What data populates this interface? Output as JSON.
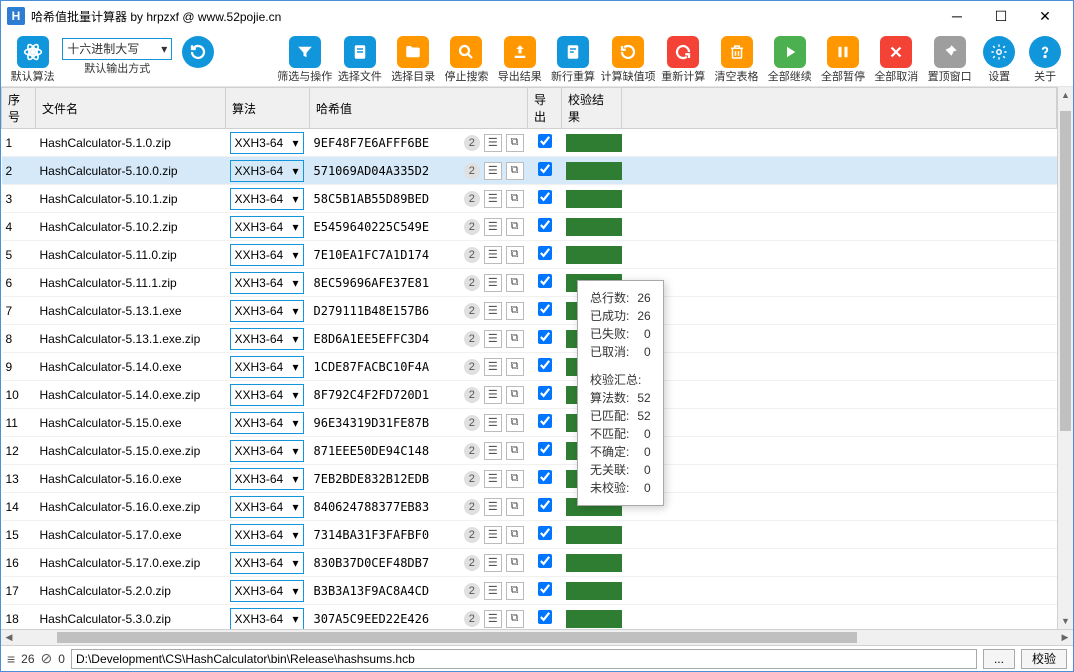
{
  "window": {
    "title": "哈希值批量计算器 by hrpzxf @ www.52pojie.cn"
  },
  "toolbar": {
    "default_algo": "默认算法",
    "output_mode_label": "默认输出方式",
    "output_mode_value": "十六进制大写",
    "filter": "筛选与操作",
    "select_file": "选择文件",
    "select_dir": "选择目录",
    "stop_search": "停止搜索",
    "export": "导出结果",
    "new_recalc": "新行重算",
    "calc_missing": "计算缺值项",
    "recalc": "重新计算",
    "clear": "清空表格",
    "all_continue": "全部继续",
    "all_pause": "全部暂停",
    "all_cancel": "全部取消",
    "pin": "置顶窗口",
    "settings": "设置",
    "about": "关于"
  },
  "columns": {
    "index": "序号",
    "filename": "文件名",
    "algo": "算法",
    "hash": "哈希值",
    "export": "导出",
    "result": "校验结果"
  },
  "rows": [
    {
      "idx": "1",
      "file": "HashCalculator-5.1.0.zip",
      "algo": "XXH3-64",
      "hash": "9EF48F7E6AFFF6BE",
      "cnt": "2",
      "sel": false
    },
    {
      "idx": "2",
      "file": "HashCalculator-5.10.0.zip",
      "algo": "XXH3-64",
      "hash": "571069AD04A335D2",
      "cnt": "2",
      "sel": true
    },
    {
      "idx": "3",
      "file": "HashCalculator-5.10.1.zip",
      "algo": "XXH3-64",
      "hash": "58C5B1AB55D89BED",
      "cnt": "2",
      "sel": false
    },
    {
      "idx": "4",
      "file": "HashCalculator-5.10.2.zip",
      "algo": "XXH3-64",
      "hash": "E5459640225C549E",
      "cnt": "2",
      "sel": false
    },
    {
      "idx": "5",
      "file": "HashCalculator-5.11.0.zip",
      "algo": "XXH3-64",
      "hash": "7E10EA1FC7A1D174",
      "cnt": "2",
      "sel": false
    },
    {
      "idx": "6",
      "file": "HashCalculator-5.11.1.zip",
      "algo": "XXH3-64",
      "hash": "8EC59696AFE37E81",
      "cnt": "2",
      "sel": false
    },
    {
      "idx": "7",
      "file": "HashCalculator-5.13.1.exe",
      "algo": "XXH3-64",
      "hash": "D279111B48E157B6",
      "cnt": "2",
      "sel": false
    },
    {
      "idx": "8",
      "file": "HashCalculator-5.13.1.exe.zip",
      "algo": "XXH3-64",
      "hash": "E8D6A1EE5EFFC3D4",
      "cnt": "2",
      "sel": false
    },
    {
      "idx": "9",
      "file": "HashCalculator-5.14.0.exe",
      "algo": "XXH3-64",
      "hash": "1CDE87FACBC10F4A",
      "cnt": "2",
      "sel": false
    },
    {
      "idx": "10",
      "file": "HashCalculator-5.14.0.exe.zip",
      "algo": "XXH3-64",
      "hash": "8F792C4F2FD720D1",
      "cnt": "2",
      "sel": false
    },
    {
      "idx": "11",
      "file": "HashCalculator-5.15.0.exe",
      "algo": "XXH3-64",
      "hash": "96E34319D31FE87B",
      "cnt": "2",
      "sel": false
    },
    {
      "idx": "12",
      "file": "HashCalculator-5.15.0.exe.zip",
      "algo": "XXH3-64",
      "hash": "871EEE50DE94C148",
      "cnt": "2",
      "sel": false
    },
    {
      "idx": "13",
      "file": "HashCalculator-5.16.0.exe",
      "algo": "XXH3-64",
      "hash": "7EB2BDE832B12EDB",
      "cnt": "2",
      "sel": false
    },
    {
      "idx": "14",
      "file": "HashCalculator-5.16.0.exe.zip",
      "algo": "XXH3-64",
      "hash": "840624788377EB83",
      "cnt": "2",
      "sel": false
    },
    {
      "idx": "15",
      "file": "HashCalculator-5.17.0.exe",
      "algo": "XXH3-64",
      "hash": "7314BA31F3FAFBF0",
      "cnt": "2",
      "sel": false
    },
    {
      "idx": "16",
      "file": "HashCalculator-5.17.0.exe.zip",
      "algo": "XXH3-64",
      "hash": "830B37D0CEF48DB7",
      "cnt": "2",
      "sel": false
    },
    {
      "idx": "17",
      "file": "HashCalculator-5.2.0.zip",
      "algo": "XXH3-64",
      "hash": "B3B3A13F9AC8A4CD",
      "cnt": "2",
      "sel": false
    },
    {
      "idx": "18",
      "file": "HashCalculator-5.3.0.zip",
      "algo": "XXH3-64",
      "hash": "307A5C9EED22E426",
      "cnt": "2",
      "sel": false
    }
  ],
  "popup": {
    "total_rows_label": "总行数:",
    "total_rows": "26",
    "succeeded_label": "已成功:",
    "succeeded": "26",
    "failed_label": "已失败:",
    "failed": "0",
    "cancelled_label": "已取消:",
    "cancelled": "0",
    "summary_label": "校验汇总:",
    "algo_count_label": "算法数:",
    "algo_count": "52",
    "matched_label": "已匹配:",
    "matched": "52",
    "unmatched_label": "不匹配:",
    "unmatched": "0",
    "uncertain_label": "不确定:",
    "uncertain": "0",
    "unrelated_label": "无关联:",
    "unrelated": "0",
    "unverified_label": "未校验:",
    "unverified": "0"
  },
  "status": {
    "count": "26",
    "count2": "0",
    "path": "D:\\Development\\CS\\HashCalculator\\bin\\Release\\hashsums.hcb",
    "verify_btn": "校验"
  }
}
